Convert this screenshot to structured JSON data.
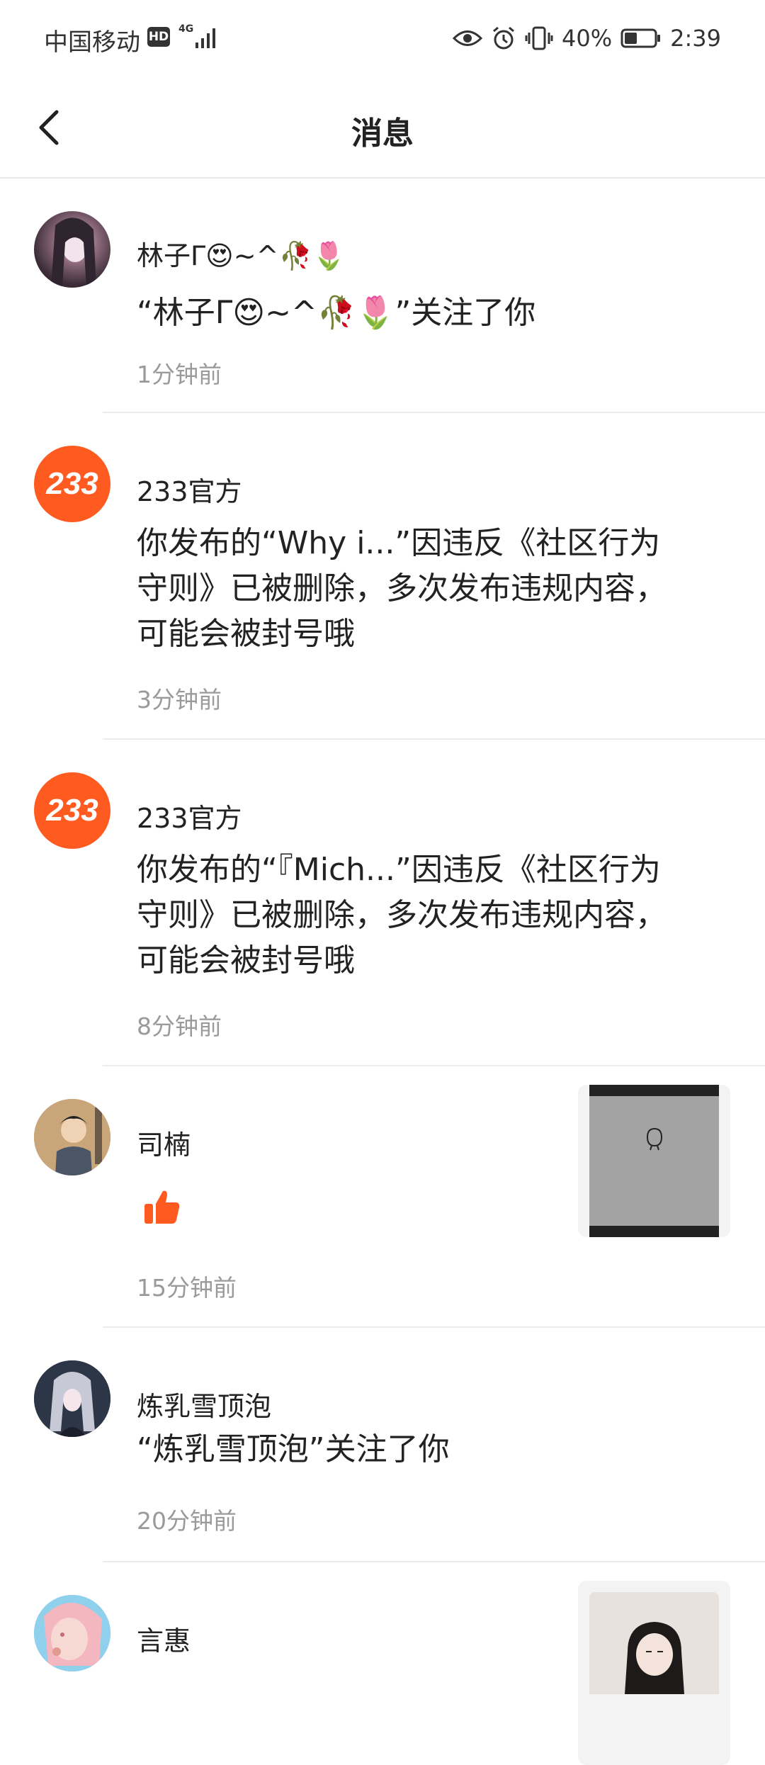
{
  "status_bar": {
    "carrier": "中国移动",
    "hd": "HD",
    "network": "4G",
    "battery": "40%",
    "time": "2:39"
  },
  "header": {
    "title": "消息"
  },
  "messages": [
    {
      "name": "林子ᒥ😍~^🥀🌷",
      "content": "“林子ᒥ😍~^🥀🌷”关注了你",
      "time": "1分钟前"
    },
    {
      "name": "233官方",
      "avatar_text": "233",
      "content": "你发布的“Why i...”因违反《社区行为守则》已被删除，多次发布违规内容，可能会被封号哦",
      "time": "3分钟前"
    },
    {
      "name": "233官方",
      "avatar_text": "233",
      "content": "你发布的“『Mich...”因违反《社区行为守则》已被删除，多次发布违规内容，可能会被封号哦",
      "time": "8分钟前"
    },
    {
      "name": "司楠",
      "time": "15分钟前",
      "icon": "thumbs-up-icon"
    },
    {
      "name": "炼乳雪顶泡",
      "content": "“炼乳雪顶泡”关注了你",
      "time": "20分钟前"
    },
    {
      "name": "言惠"
    }
  ],
  "colors": {
    "brand_orange": "#ff5a1f",
    "divider": "#ececec",
    "muted_text": "#9a9a9a"
  }
}
